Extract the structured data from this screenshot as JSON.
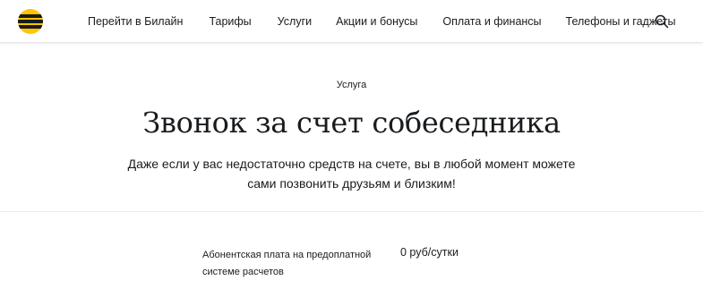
{
  "header": {
    "logo": "beeline-logo",
    "nav": [
      {
        "label": "Перейти в Билайн"
      },
      {
        "label": "Тарифы"
      },
      {
        "label": "Услуги"
      },
      {
        "label": "Акции и бонусы"
      },
      {
        "label": "Оплата и финансы"
      },
      {
        "label": "Телефоны и гаджеты"
      }
    ],
    "search_icon": "search-icon"
  },
  "hero": {
    "eyebrow": "Услуга",
    "title": "Звонок за счет собеседника",
    "subtitle": "Даже если у вас недостаточно средств на счете, вы в любой момент можете сами позвонить друзьям и близким!"
  },
  "pricing": {
    "label": "Абонентская плата на предоплатной системе расчетов",
    "value": "0 руб/сутки"
  },
  "colors": {
    "brand_yellow": "#ffc500",
    "text": "#191c1f"
  }
}
